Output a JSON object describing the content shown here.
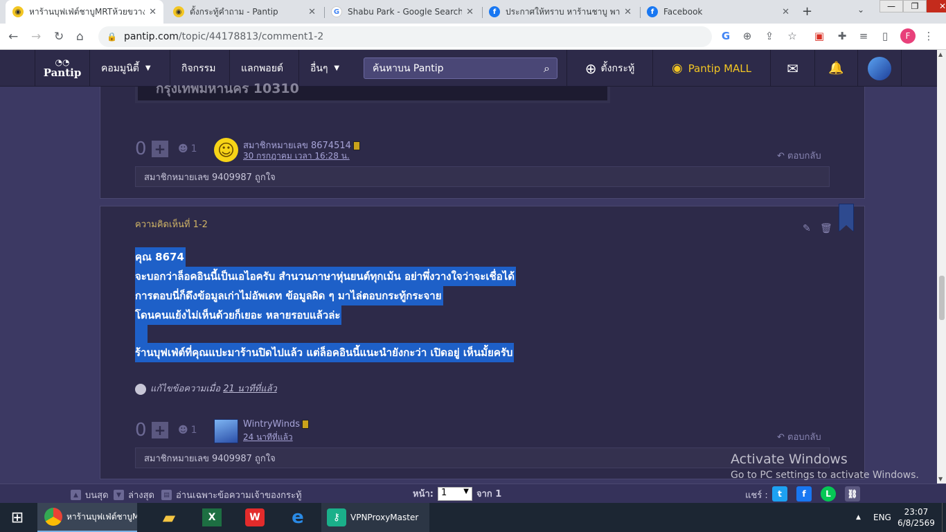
{
  "browser": {
    "tabs": [
      {
        "title": "หาร้านบุฟเฟ่ต์ชาบูMRTห้วยขวางที่อร่อ",
        "favicon": "pantip-icon",
        "active": true
      },
      {
        "title": "ตั้งกระทู้คำถาม - Pantip",
        "favicon": "pantip-icon",
        "active": false
      },
      {
        "title": "Shabu Park - Google Search",
        "favicon": "google-icon",
        "active": false
      },
      {
        "title": "ประกาศให้ทราบ หาร้านชาบู พาร์ค...",
        "favicon": "facebook-icon",
        "active": false
      },
      {
        "title": "Facebook",
        "favicon": "facebook-icon",
        "active": false
      }
    ],
    "url_host": "pantip.com",
    "url_path": "/topic/44178813/comment1-2",
    "profile_initial": "F"
  },
  "pantip": {
    "logo": "Pantip",
    "menu": [
      "คอมมูนิตี้",
      "กิจกรรม",
      "แลกพอยต์",
      "อื่นๆ"
    ],
    "search_placeholder": "ค้นหาบน Pantip",
    "create_topic": "ตั้งกระทู้",
    "mall": "Pantip MALL"
  },
  "prev_comment": {
    "visible_text": "กรุงเทพมหานคร 10310",
    "vote_count": "0",
    "emotion_count": "1",
    "username": "สมาชิกหมายเลข 8674514",
    "date": "30 กรกฎาคม เวลา 16:28 น.",
    "reply": "ตอบกลับ",
    "likes": "สมาชิกหมายเลข 9409987 ถูกใจ"
  },
  "comment": {
    "label": "ความคิดเห็นที่ 1-2",
    "lines": [
      "คุณ 8674",
      "จะบอกว่าล็อคอินนี้เป็นเอไอครับ สำนวนภาษาหุ่นยนต์ทุกเม้น อย่าพึ่งวางใจว่าจะเชื่อได้",
      "การตอบนี่ก็ดึงข้อมูลเก่าไม่อัพเดท ข้อมูลผิด ๆ มาไล่ตอบกระทู้กระจาย",
      "โดนคนแย้งไม่เห็นด้วยก็เยอะ หลายรอบแล้วล่ะ",
      "",
      "ร้านบุฟเฟ่ต์ที่คุณแปะมาร้านปิดไปแล้ว แต่ล็อคอินนี้แนะนำยังกะว่า เปิดอยู่ เห็นมั้ยครับ"
    ],
    "edited_prefix": "แก้ไขข้อความเมื่อ",
    "edited_time": "21 นาทีที่แล้ว",
    "vote_count": "0",
    "emotion_count": "1",
    "username": "WintryWinds",
    "date": "24 นาทีที่แล้ว",
    "reply": "ตอบกลับ",
    "likes": "สมาชิกหมายเลข 9409987 ถูกใจ"
  },
  "toolbar": {
    "top": "บนสุด",
    "bottom": "ล่างสุด",
    "owner_only": "อ่านเฉพาะข้อความเจ้าของกระทู้",
    "page_label": "หน้า:",
    "page_value": "1",
    "of_label": "จาก 1",
    "share_label": "แชร์ :"
  },
  "watermark": {
    "line1": "Activate Windows",
    "line2": "Go to PC settings to activate Windows."
  },
  "taskbar": {
    "chrome_label": "หาร้านบุฟเฟ่ต์ชาบูM...",
    "vpn_label": "VPNProxyMaster",
    "lang": "ENG",
    "time": "23:07",
    "date": "6/8/2569"
  }
}
